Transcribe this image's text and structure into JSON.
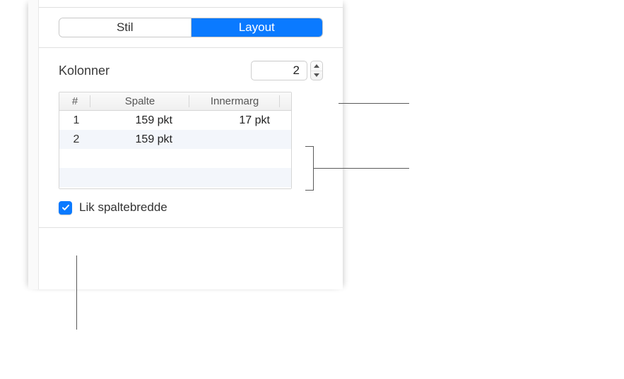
{
  "tabs": {
    "stil": "Stil",
    "layout": "Layout"
  },
  "columns": {
    "label": "Kolonner",
    "value": "2"
  },
  "table": {
    "headers": {
      "num": "#",
      "spalte": "Spalte",
      "innermarg": "Innermarg"
    },
    "rows": [
      {
        "num": "1",
        "spalte": "159 pkt",
        "innermarg": "17 pkt"
      },
      {
        "num": "2",
        "spalte": "159 pkt",
        "innermarg": ""
      }
    ]
  },
  "equal_width": {
    "label": "Lik spaltebredde",
    "checked": true
  }
}
